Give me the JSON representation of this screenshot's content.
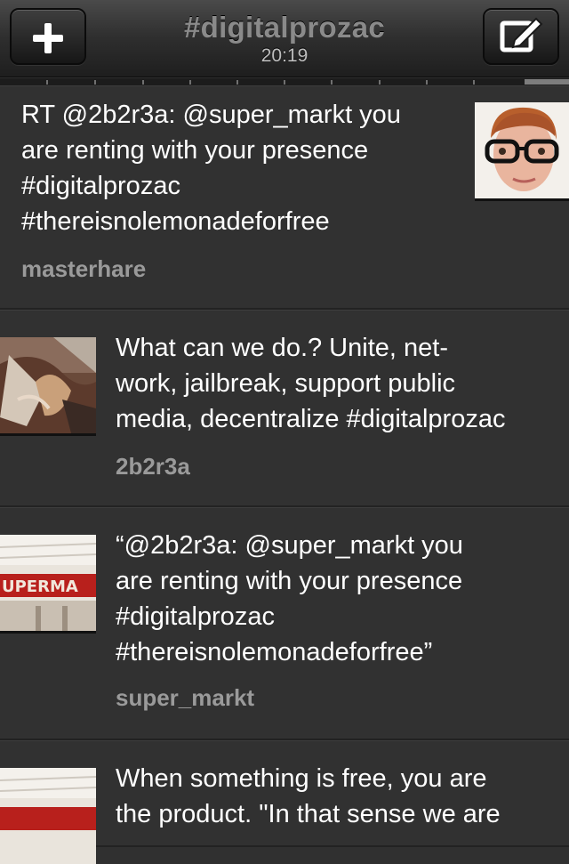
{
  "header": {
    "title": "#digitalprozac",
    "time": "20:19",
    "add_icon": "plus-icon",
    "compose_icon": "compose-icon"
  },
  "tweets": [
    {
      "text": "RT @2b2r3a: @super_markt you\nare renting with your presence\n#digitalprozac\n#thereisnolemonadeforfree",
      "user": "masterhare",
      "avatar": "portrait-with-glasses"
    },
    {
      "text": "What can we do.? Unite, net-\nwork, jailbreak, support public\nmedia, decentralize #digitalprozac",
      "user": "2b2r3a",
      "avatar": "painted-figure"
    },
    {
      "text": "“@2b2r3a: @super_markt you\nare renting with your presence\n#digitalprozac\n#thereisnolemonadeforfree”",
      "user": "super_markt",
      "avatar": "supermarkt-sign"
    },
    {
      "text": "When something is free, you are\nthe product. \"In that sense we are",
      "user": "",
      "avatar": "supermarkt-sign"
    }
  ]
}
